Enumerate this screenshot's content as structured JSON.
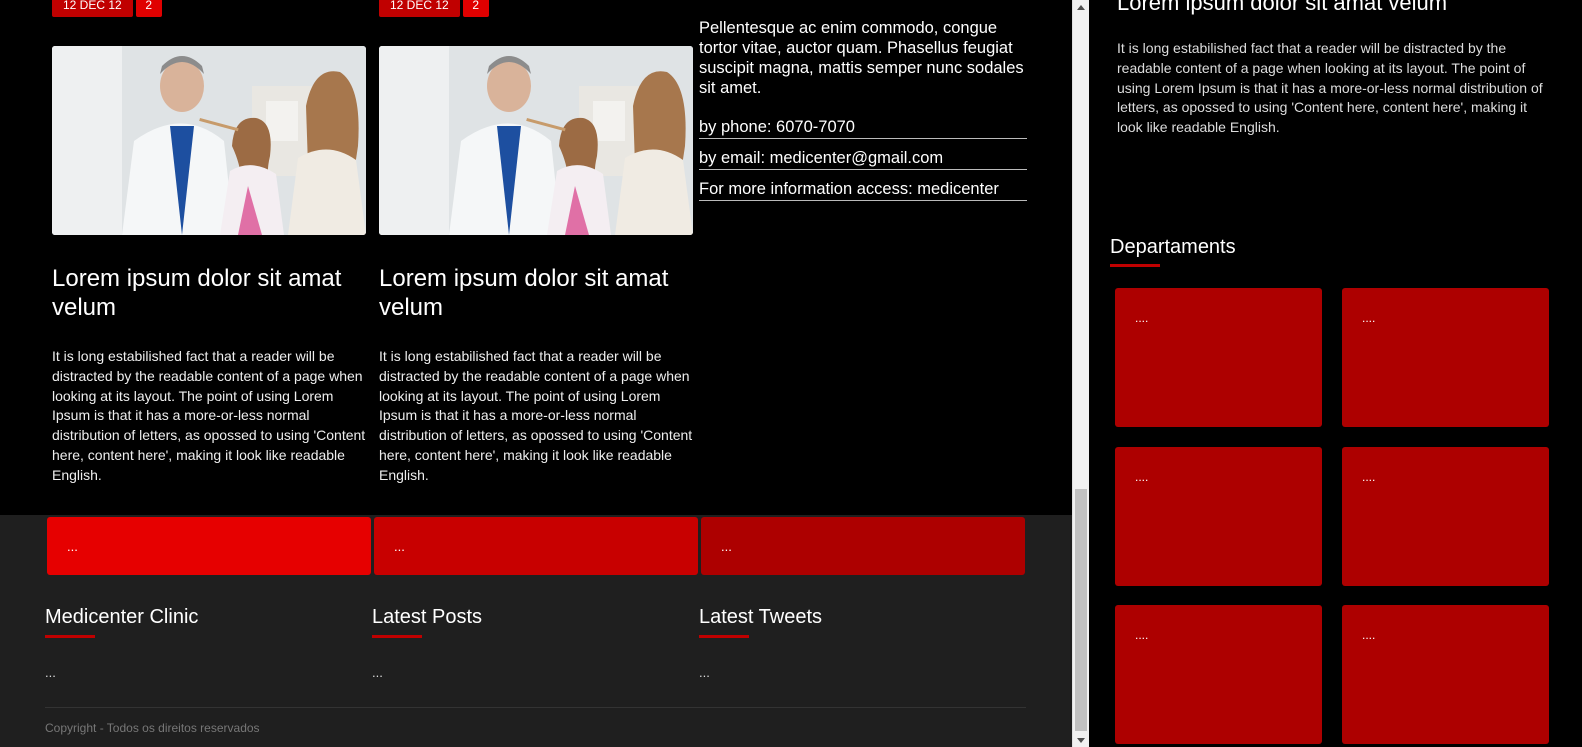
{
  "posts": [
    {
      "date": "12 DEC 12",
      "comments": "2",
      "title": "Lorem ipsum dolor sit amat velum",
      "body": "It is long estabilished fact that a reader will be distracted by the readable content of a page when looking at its layout. The point of using Lorem Ipsum is that it has a more-or-less normal distribution of letters, as opossed to using 'Content here, content here', making it look like readable English."
    },
    {
      "date": "12 DEC 12",
      "comments": "2",
      "title": "Lorem ipsum dolor sit amat velum",
      "body": "It is long estabilished fact that a reader will be distracted by the readable content of a page when looking at its layout. The point of using Lorem Ipsum is that it has a more-or-less normal distribution of letters, as opossed to using 'Content here, content here', making it look like readable English."
    }
  ],
  "contact": {
    "intro": "Pellentesque ac enim commodo, congue tortor vitae, auctor quam. Phasellus feugiat suscipit magna, mattis semper nunc sodales sit amet.",
    "phone": "by phone: 6070-7070",
    "email": "by email: medicenter@gmail.com",
    "info": "For more information access: medicenter"
  },
  "footer": {
    "features": [
      {
        "label": "...",
        "color": "#e60000"
      },
      {
        "label": "...",
        "color": "#c80000"
      },
      {
        "label": "...",
        "color": "#ad0000"
      }
    ],
    "columns": [
      {
        "title": "Medicenter Clinic",
        "value": "..."
      },
      {
        "title": "Latest Posts",
        "value": "..."
      },
      {
        "title": "Latest Tweets",
        "value": "..."
      }
    ],
    "copyright": "Copyright - Todos os direitos reservados"
  },
  "sidebar": {
    "title": "Lorem ipsum dolor sit amat velum",
    "text": "It is long estabilished fact that a reader will be distracted by the readable content of a page when looking at its layout. The point of using Lorem Ipsum is that it has a more-or-less normal distribution of letters, as opossed to using 'Content here, content here', making it look like readable English.",
    "departments_title": "Departaments",
    "departments": [
      "....",
      "....",
      "....",
      "....",
      "....",
      "...."
    ]
  },
  "colors": {
    "accent": "#c00000",
    "background": "#000000",
    "footer": "#1f1f1f"
  }
}
